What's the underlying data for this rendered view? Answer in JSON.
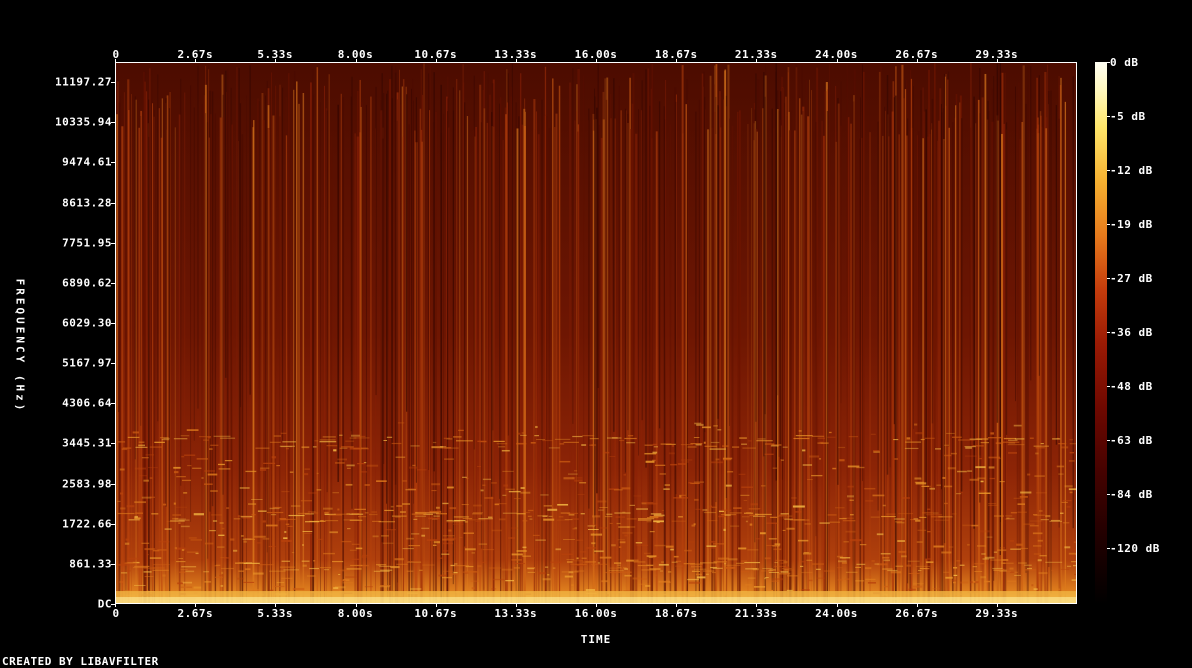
{
  "chart_data": {
    "type": "heatmap",
    "title": "",
    "xlabel": "TIME",
    "ylabel": "FREQUENCY (Hz)",
    "x_ticks": [
      "0",
      "2.67s",
      "5.33s",
      "8.00s",
      "10.67s",
      "13.33s",
      "16.00s",
      "18.67s",
      "21.33s",
      "24.00s",
      "26.67s",
      "29.33s"
    ],
    "x_tick_values": [
      0,
      2.67,
      5.33,
      8.0,
      10.67,
      13.33,
      16.0,
      18.67,
      21.33,
      24.0,
      26.67,
      29.33
    ],
    "xlim": [
      0,
      32.0
    ],
    "y_ticks": [
      "DC",
      "861.33",
      "1722.66",
      "2583.98",
      "3445.31",
      "4306.64",
      "5167.97",
      "6029.30",
      "6890.62",
      "7751.95",
      "8613.28",
      "9474.61",
      "10335.94",
      "11197.27"
    ],
    "y_tick_values": [
      0,
      861.33,
      1722.66,
      2583.98,
      3445.31,
      4306.64,
      5167.97,
      6029.3,
      6890.62,
      7751.95,
      8613.28,
      9474.61,
      10335.94,
      11197.27
    ],
    "ylim": [
      0,
      11628
    ],
    "colorbar_ticks": [
      "0 dB",
      "-5 dB",
      "-12 dB",
      "-19 dB",
      "-27 dB",
      "-36 dB",
      "-48 dB",
      "-63 dB",
      "-84 dB",
      "-120 dB"
    ],
    "colorbar_values": [
      0,
      -5,
      -12,
      -19,
      -27,
      -36,
      -48,
      -63,
      -84,
      -120
    ],
    "colormap": "intensity (black-red-orange-yellow-white)",
    "footer": "CREATED BY LIBAVFILTER"
  }
}
